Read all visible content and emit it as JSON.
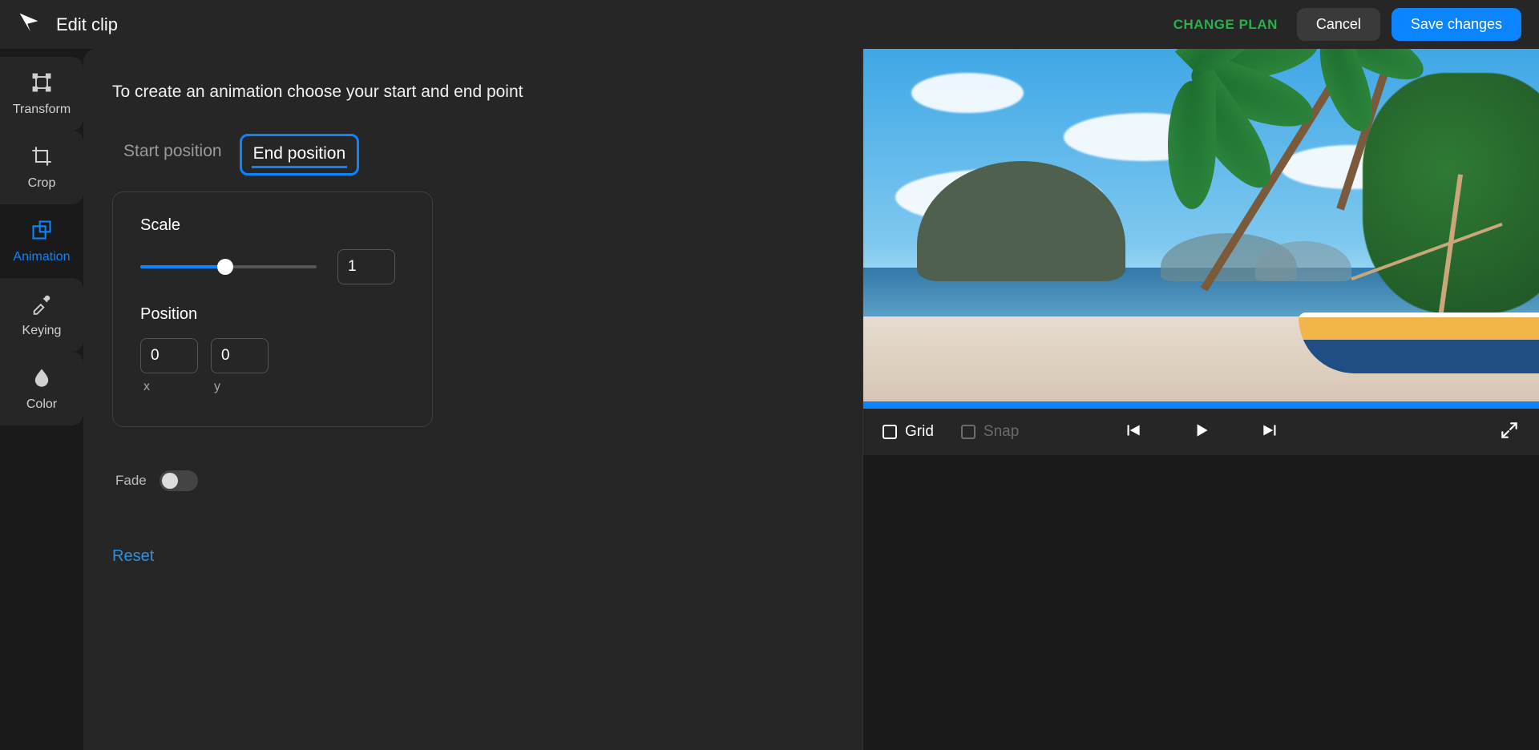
{
  "header": {
    "title": "Edit clip",
    "change_plan": "CHANGE PLAN",
    "cancel": "Cancel",
    "save": "Save changes"
  },
  "sidebar": {
    "items": [
      {
        "id": "transform",
        "label": "Transform"
      },
      {
        "id": "crop",
        "label": "Crop"
      },
      {
        "id": "animation",
        "label": "Animation"
      },
      {
        "id": "keying",
        "label": "Keying"
      },
      {
        "id": "color",
        "label": "Color"
      }
    ],
    "active": "animation"
  },
  "animation": {
    "instruction": "To create an animation choose your start and end point",
    "tabs": {
      "start": "Start position",
      "end": "End position",
      "active": "end"
    },
    "scale": {
      "label": "Scale",
      "value": "1"
    },
    "position": {
      "label": "Position",
      "x": {
        "value": "0",
        "axis": "x"
      },
      "y": {
        "value": "0",
        "axis": "y"
      }
    },
    "fade": {
      "label": "Fade",
      "on": false
    },
    "reset": "Reset"
  },
  "preview": {
    "controls": {
      "grid": {
        "label": "Grid",
        "checked": false
      },
      "snap": {
        "label": "Snap",
        "checked": false
      }
    }
  }
}
